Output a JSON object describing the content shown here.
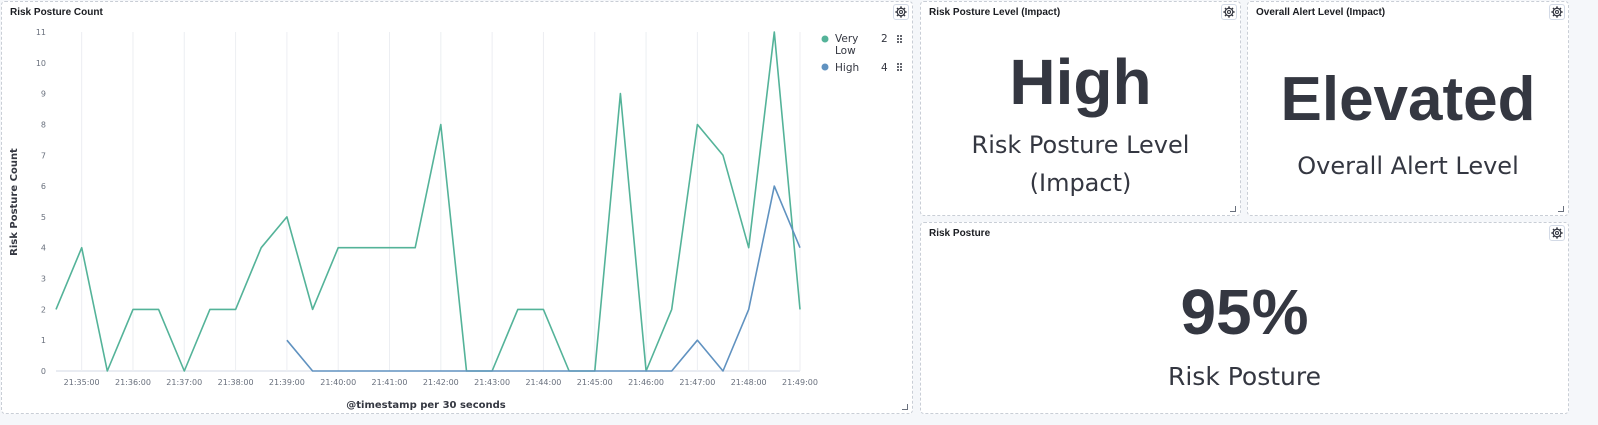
{
  "colors": {
    "very_low": "#54b399",
    "high": "#6092c0",
    "text": "#343741"
  },
  "panels": {
    "risk_posture_count": {
      "title": "Risk Posture Count"
    },
    "risk_posture_level": {
      "title": "Risk Posture Level (Impact)",
      "value": "High",
      "label_line1": "Risk Posture Level",
      "label_line2": "(Impact)"
    },
    "overall_alert_level": {
      "title": "Overall Alert Level (Impact)",
      "value": "Elevated",
      "label": "Overall Alert Level"
    },
    "risk_posture": {
      "title": "Risk Posture",
      "value": "95%",
      "label": "Risk Posture"
    }
  },
  "chart_data": {
    "type": "line",
    "xlabel": "@timestamp per 30 seconds",
    "ylabel": "Risk Posture Count",
    "ylim": [
      0,
      11
    ],
    "yticks": [
      "0",
      "1",
      "2",
      "3",
      "4",
      "5",
      "6",
      "7",
      "8",
      "9",
      "10",
      "11"
    ],
    "xtick_labels": [
      "21:35:00",
      "21:36:00",
      "21:37:00",
      "21:38:00",
      "21:39:00",
      "21:40:00",
      "21:41:00",
      "21:42:00",
      "21:43:00",
      "21:44:00",
      "21:45:00",
      "21:46:00",
      "21:47:00",
      "21:48:00",
      "21:49:00"
    ],
    "legend_position": "top-right",
    "series": [
      {
        "name": "Very Low",
        "legend_value": "2",
        "color": "#54b399",
        "x": [
          "21:34:30",
          "21:35:00",
          "21:35:30",
          "21:36:00",
          "21:36:30",
          "21:37:00",
          "21:37:30",
          "21:38:00",
          "21:38:30",
          "21:39:00",
          "21:39:30",
          "21:40:00",
          "21:40:30",
          "21:41:00",
          "21:41:30",
          "21:42:00",
          "21:42:30",
          "21:43:00",
          "21:43:30",
          "21:44:00",
          "21:44:30",
          "21:45:00",
          "21:45:30",
          "21:46:00",
          "21:46:30",
          "21:47:00",
          "21:47:30",
          "21:48:00",
          "21:48:30",
          "21:49:00"
        ],
        "values": [
          2,
          4,
          0,
          2,
          2,
          0,
          2,
          2,
          4,
          5,
          2,
          4,
          4,
          4,
          4,
          8,
          0,
          0,
          2,
          2,
          0,
          0,
          9,
          0,
          2,
          8,
          7,
          4,
          11,
          2
        ]
      },
      {
        "name": "High",
        "legend_value": "4",
        "color": "#6092c0",
        "x": [
          "21:39:00",
          "21:39:30",
          "21:40:00",
          "21:40:30",
          "21:41:00",
          "21:41:30",
          "21:42:00",
          "21:42:30",
          "21:43:00",
          "21:43:30",
          "21:44:00",
          "21:44:30",
          "21:45:00",
          "21:45:30",
          "21:46:00",
          "21:46:30",
          "21:47:00",
          "21:47:30",
          "21:48:00",
          "21:48:30",
          "21:49:00"
        ],
        "values": [
          1,
          0,
          0,
          0,
          0,
          0,
          0,
          0,
          0,
          0,
          0,
          0,
          0,
          0,
          0,
          0,
          1,
          0,
          2,
          6,
          4
        ]
      }
    ]
  }
}
